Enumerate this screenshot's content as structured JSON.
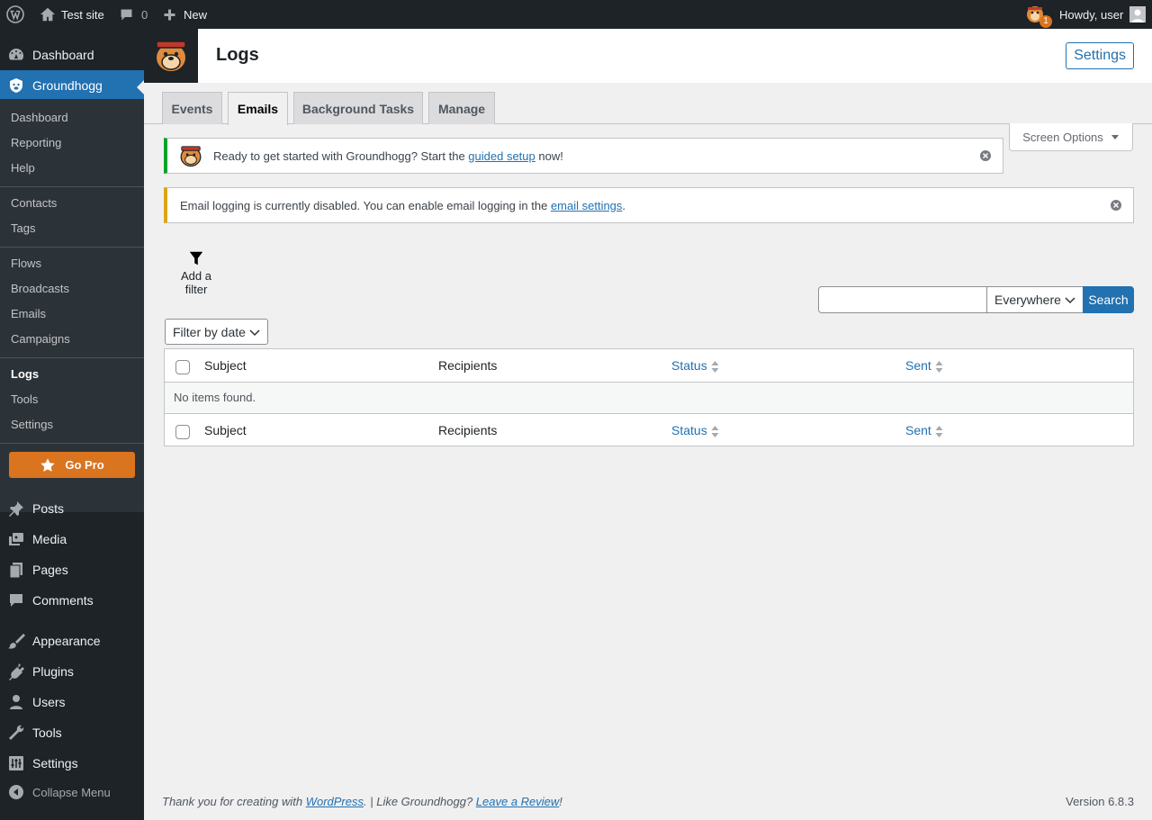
{
  "adminbar": {
    "site_name": "Test site",
    "comments_count": "0",
    "new_label": "New",
    "notification_count": "1",
    "howdy": "Howdy, user"
  },
  "sidebar": {
    "dashboard": "Dashboard",
    "groundhogg": "Groundhogg",
    "submenu": {
      "dashboard": "Dashboard",
      "reporting": "Reporting",
      "help": "Help",
      "contacts": "Contacts",
      "tags": "Tags",
      "flows": "Flows",
      "broadcasts": "Broadcasts",
      "emails": "Emails",
      "campaigns": "Campaigns",
      "logs": "Logs",
      "tools": "Tools",
      "settings": "Settings",
      "go_pro": "Go Pro"
    },
    "posts": "Posts",
    "media": "Media",
    "pages": "Pages",
    "comments": "Comments",
    "appearance": "Appearance",
    "plugins": "Plugins",
    "users": "Users",
    "tools": "Tools",
    "settings": "Settings",
    "collapse": "Collapse Menu"
  },
  "header": {
    "title": "Logs",
    "settings_label": "Settings"
  },
  "tabs": [
    "Events",
    "Emails",
    "Background Tasks",
    "Manage"
  ],
  "screen_options": "Screen Options",
  "notices": {
    "setup_before": "Ready to get started with Groundhogg? Start the ",
    "setup_link": "guided setup",
    "setup_after": " now!",
    "logging_before": "Email logging is currently disabled. You can enable email logging in the ",
    "logging_link": "email settings",
    "logging_after": "."
  },
  "filters": {
    "add_filter": "Add a filter",
    "search_scope": "Everywhere",
    "search_button": "Search",
    "date_filter": "Filter by date"
  },
  "table": {
    "columns": [
      "Subject",
      "Recipients",
      "Status",
      "Sent"
    ],
    "empty": "No items found."
  },
  "footer": {
    "thanks_before": "Thank you for creating with ",
    "wordpress_link": "WordPress",
    "thanks_mid": ". | Like Groundhogg? ",
    "review_link": "Leave a Review",
    "thanks_after": "!",
    "version": "Version 6.8.3"
  },
  "colors": {
    "admin_dark": "#1d2327",
    "accent_blue": "#2271b1",
    "go_pro_orange": "#db741e",
    "notice_success": "#00a32a",
    "notice_warning": "#dba617"
  }
}
